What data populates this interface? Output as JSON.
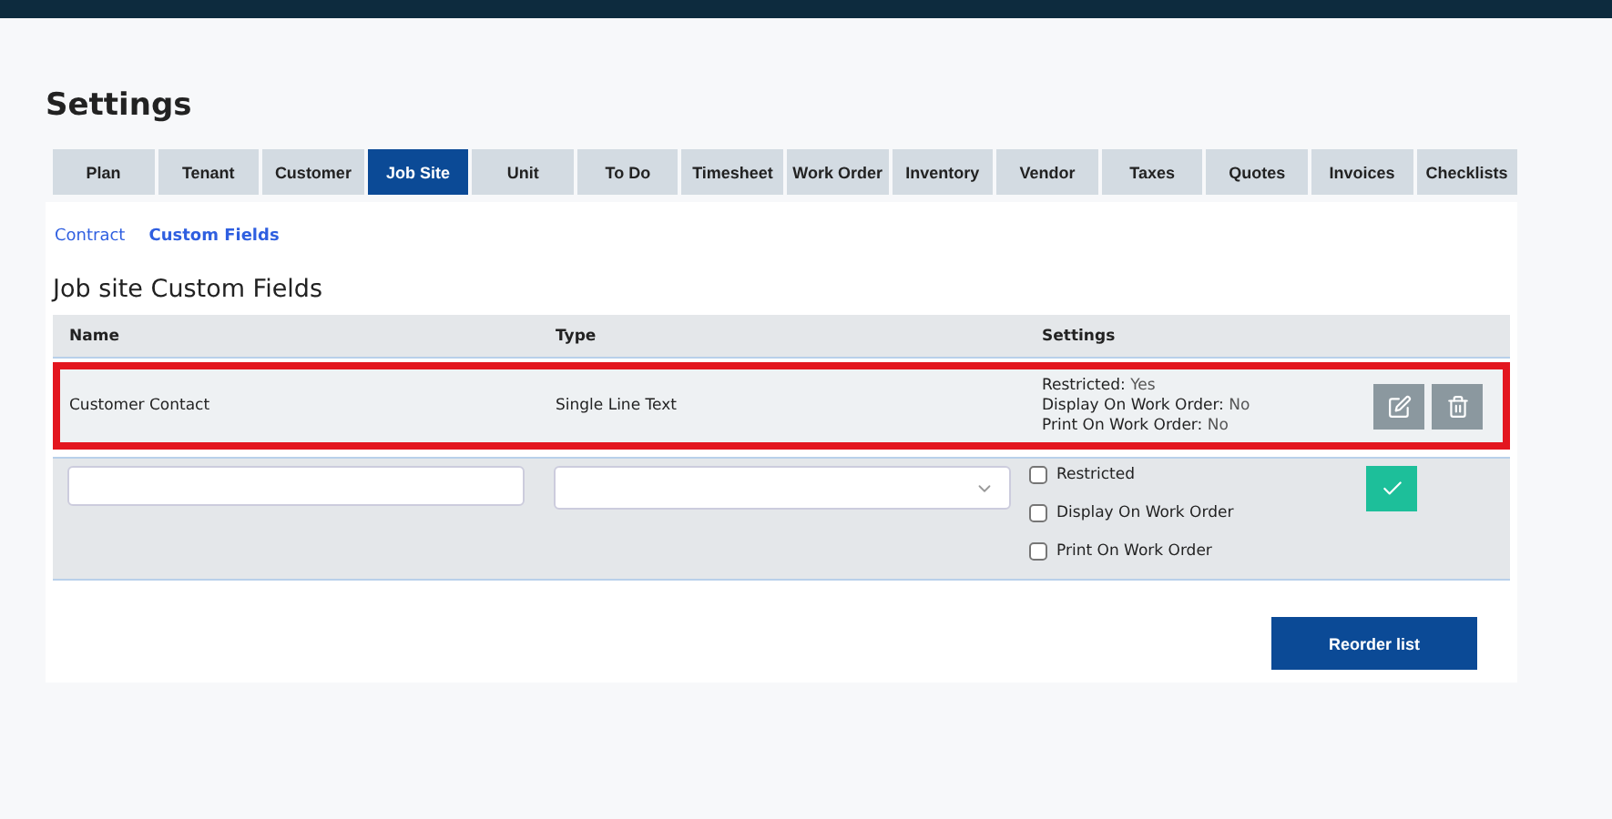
{
  "page_title": "Settings",
  "tabs": [
    {
      "label": "Plan",
      "selected": false
    },
    {
      "label": "Tenant",
      "selected": false
    },
    {
      "label": "Customer",
      "selected": false
    },
    {
      "label": "Job Site",
      "selected": true
    },
    {
      "label": "Unit",
      "selected": false
    },
    {
      "label": "To Do",
      "selected": false
    },
    {
      "label": "Timesheet",
      "selected": false
    },
    {
      "label": "Work Order",
      "selected": false
    },
    {
      "label": "Inventory",
      "selected": false
    },
    {
      "label": "Vendor",
      "selected": false
    },
    {
      "label": "Taxes",
      "selected": false
    },
    {
      "label": "Quotes",
      "selected": false
    },
    {
      "label": "Invoices",
      "selected": false
    },
    {
      "label": "Checklists",
      "selected": false
    }
  ],
  "subtabs": [
    {
      "label": "Contract",
      "selected": false
    },
    {
      "label": "Custom Fields",
      "selected": true
    }
  ],
  "section_title": "Job site Custom Fields",
  "table": {
    "columns": [
      "Name",
      "Type",
      "Settings"
    ],
    "rows": [
      {
        "name": "Customer Contact",
        "type": "Single Line Text",
        "highlighted": true,
        "settings": [
          {
            "label": "Restricted:",
            "value": "Yes"
          },
          {
            "label": "Display On Work Order:",
            "value": "No"
          },
          {
            "label": "Print On Work Order:",
            "value": "No"
          }
        ]
      }
    ]
  },
  "new_field": {
    "options": [
      {
        "label": "Restricted",
        "checked": false
      },
      {
        "label": "Display On Work Order",
        "checked": false
      },
      {
        "label": "Print On Work Order",
        "checked": false
      }
    ]
  },
  "reorder_button": "Reorder list"
}
